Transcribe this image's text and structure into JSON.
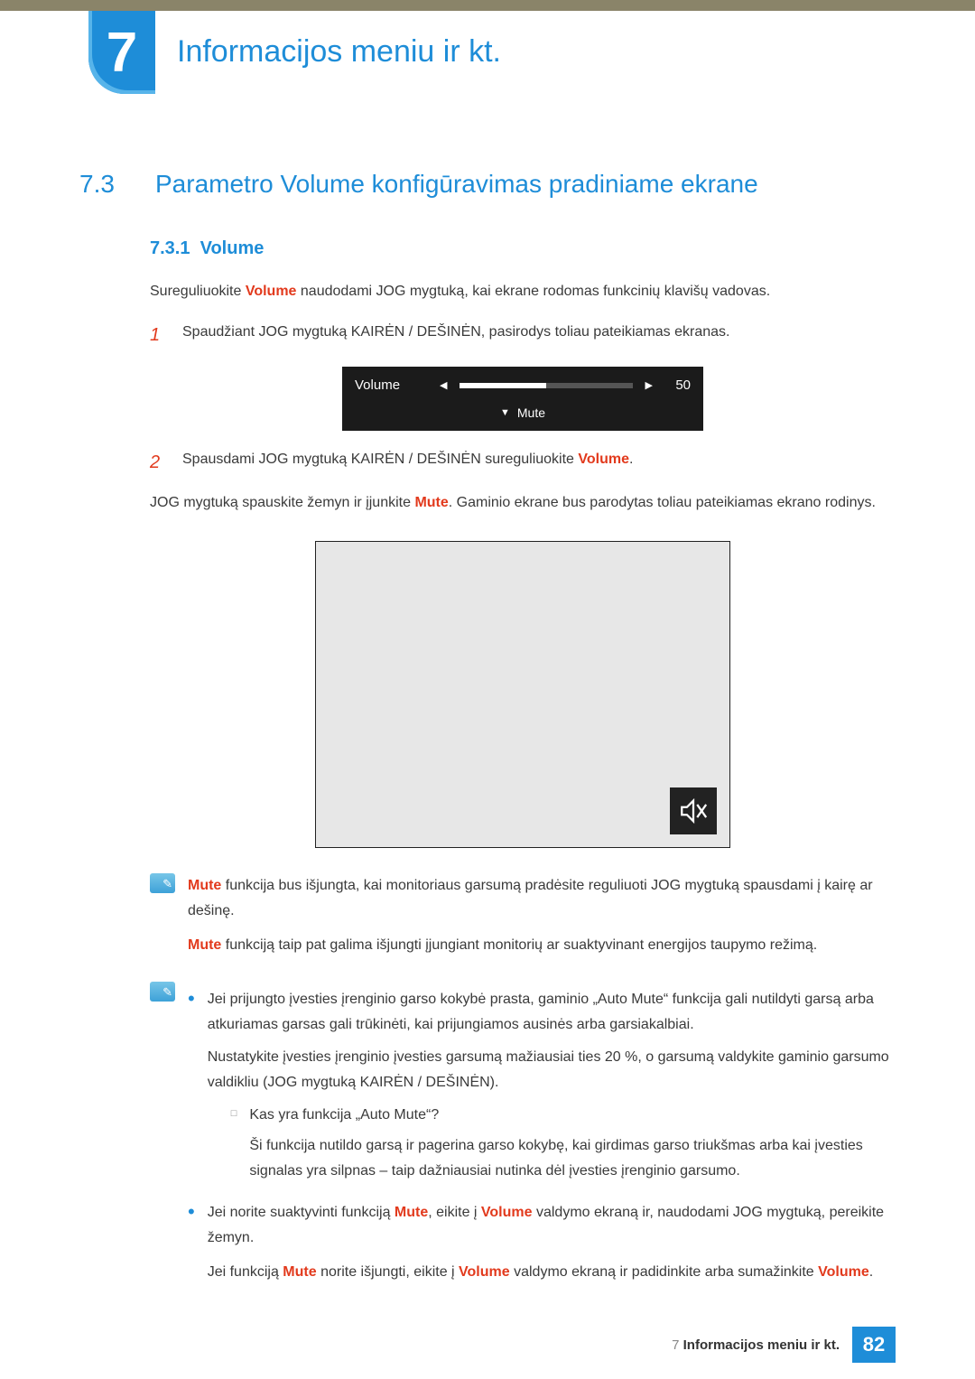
{
  "chapter": {
    "number": "7",
    "title": "Informacijos meniu ir kt."
  },
  "section": {
    "number": "7.3",
    "title": "Parametro Volume konfigūravimas pradiniame ekrane"
  },
  "subsection": {
    "number": "7.3.1",
    "title": "Volume"
  },
  "intro": {
    "pre": "Sureguliuokite ",
    "kw": "Volume",
    "post": " naudodami JOG mygtuką, kai ekrane rodomas funkcinių klavišų vadovas."
  },
  "steps": {
    "s1": {
      "num": "1",
      "text": "Spaudžiant JOG mygtuką KAIRĖN / DEŠINĖN, pasirodys toliau pateikiamas ekranas."
    },
    "s2": {
      "num": "2",
      "pre": "Spausdami JOG mygtuką KAIRĖN / DEŠINĖN sureguliuokite ",
      "kw": "Volume",
      "post": "."
    }
  },
  "osd": {
    "label": "Volume",
    "value": "50",
    "mute": "Mute"
  },
  "para2": {
    "pre": "JOG mygtuką spauskite žemyn ir įjunkite ",
    "kw": "Mute",
    "post": ". Gaminio ekrane bus parodytas toliau pateikiamas ekrano rodinys."
  },
  "note1": {
    "l1": {
      "kw": "Mute",
      "text": " funkcija bus išjungta, kai monitoriaus garsumą pradėsite reguliuoti JOG mygtuką spausdami į kairę ar dešinę."
    },
    "l2": {
      "kw": "Mute",
      "text": " funkciją taip pat galima išjungti įjungiant monitorių ar suaktyvinant energijos taupymo režimą."
    }
  },
  "note2": {
    "b1": "Jei prijungto įvesties įrenginio garso kokybė prasta, gaminio „Auto Mute“ funkcija gali nutildyti garsą arba atkuriamas garsas gali trūkinėti, kai prijungiamos ausinės arba garsiakalbiai.",
    "b1b": "Nustatykite įvesties įrenginio įvesties garsumą mažiausiai ties 20 %, o garsumą valdykite gaminio garsumo valdikliu (JOG mygtuką KAIRĖN / DEŠINĖN).",
    "sub_q": "Kas yra funkcija „Auto Mute“?",
    "sub_a": "Ši funkcija nutildo garsą ir pagerina garso kokybę, kai girdimas garso triukšmas arba kai įvesties signalas yra silpnas – taip dažniausiai nutinka dėl įvesties įrenginio garsumo.",
    "b2": {
      "p1": "Jei norite suaktyvinti funkciją ",
      "kw1": "Mute",
      "p2": ", eikite į ",
      "kw2": "Volume",
      "p3": " valdymo ekraną ir, naudodami JOG mygtuką, pereikite žemyn."
    },
    "b2b": {
      "p1": "Jei funkciją ",
      "kw1": "Mute",
      "p2": " norite išjungti, eikite į ",
      "kw2": "Volume",
      "p3": " valdymo ekraną ir padidinkite arba sumažinkite ",
      "kw3": "Volume",
      "p4": "."
    }
  },
  "footer": {
    "chapter": "7",
    "title": "Informacijos meniu ir kt.",
    "page": "82"
  }
}
